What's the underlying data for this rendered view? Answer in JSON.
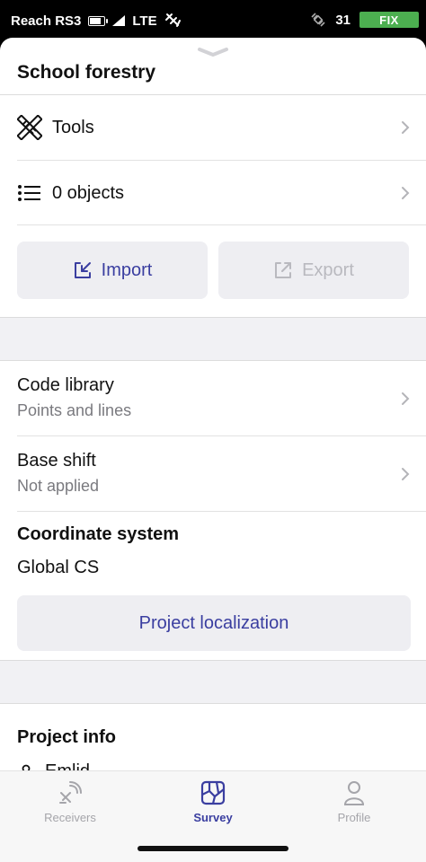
{
  "status_bar": {
    "carrier": "Reach RS3",
    "network": "LTE",
    "satellites": "31",
    "fix_status": "FIX",
    "colors": {
      "fix_badge": "#4caf50"
    }
  },
  "project": {
    "title": "School forestry"
  },
  "menu": {
    "tools_label": "Tools",
    "objects_label": "0 objects"
  },
  "actions": {
    "import_label": "Import",
    "export_label": "Export"
  },
  "settings": {
    "code_library": {
      "title": "Code library",
      "value": "Points and lines"
    },
    "base_shift": {
      "title": "Base shift",
      "value": "Not applied"
    },
    "coordinate_system": {
      "title": "Coordinate system",
      "value": "Global CS"
    },
    "localization_button": "Project localization"
  },
  "project_info": {
    "title": "Project info",
    "author": "Emlid"
  },
  "bottom_nav": {
    "items": [
      {
        "label": "Receivers",
        "icon": "receiver-icon",
        "active": false
      },
      {
        "label": "Survey",
        "icon": "survey-map-icon",
        "active": true
      },
      {
        "label": "Profile",
        "icon": "profile-icon",
        "active": false
      }
    ]
  },
  "colors": {
    "accent": "#3a3ea0"
  }
}
